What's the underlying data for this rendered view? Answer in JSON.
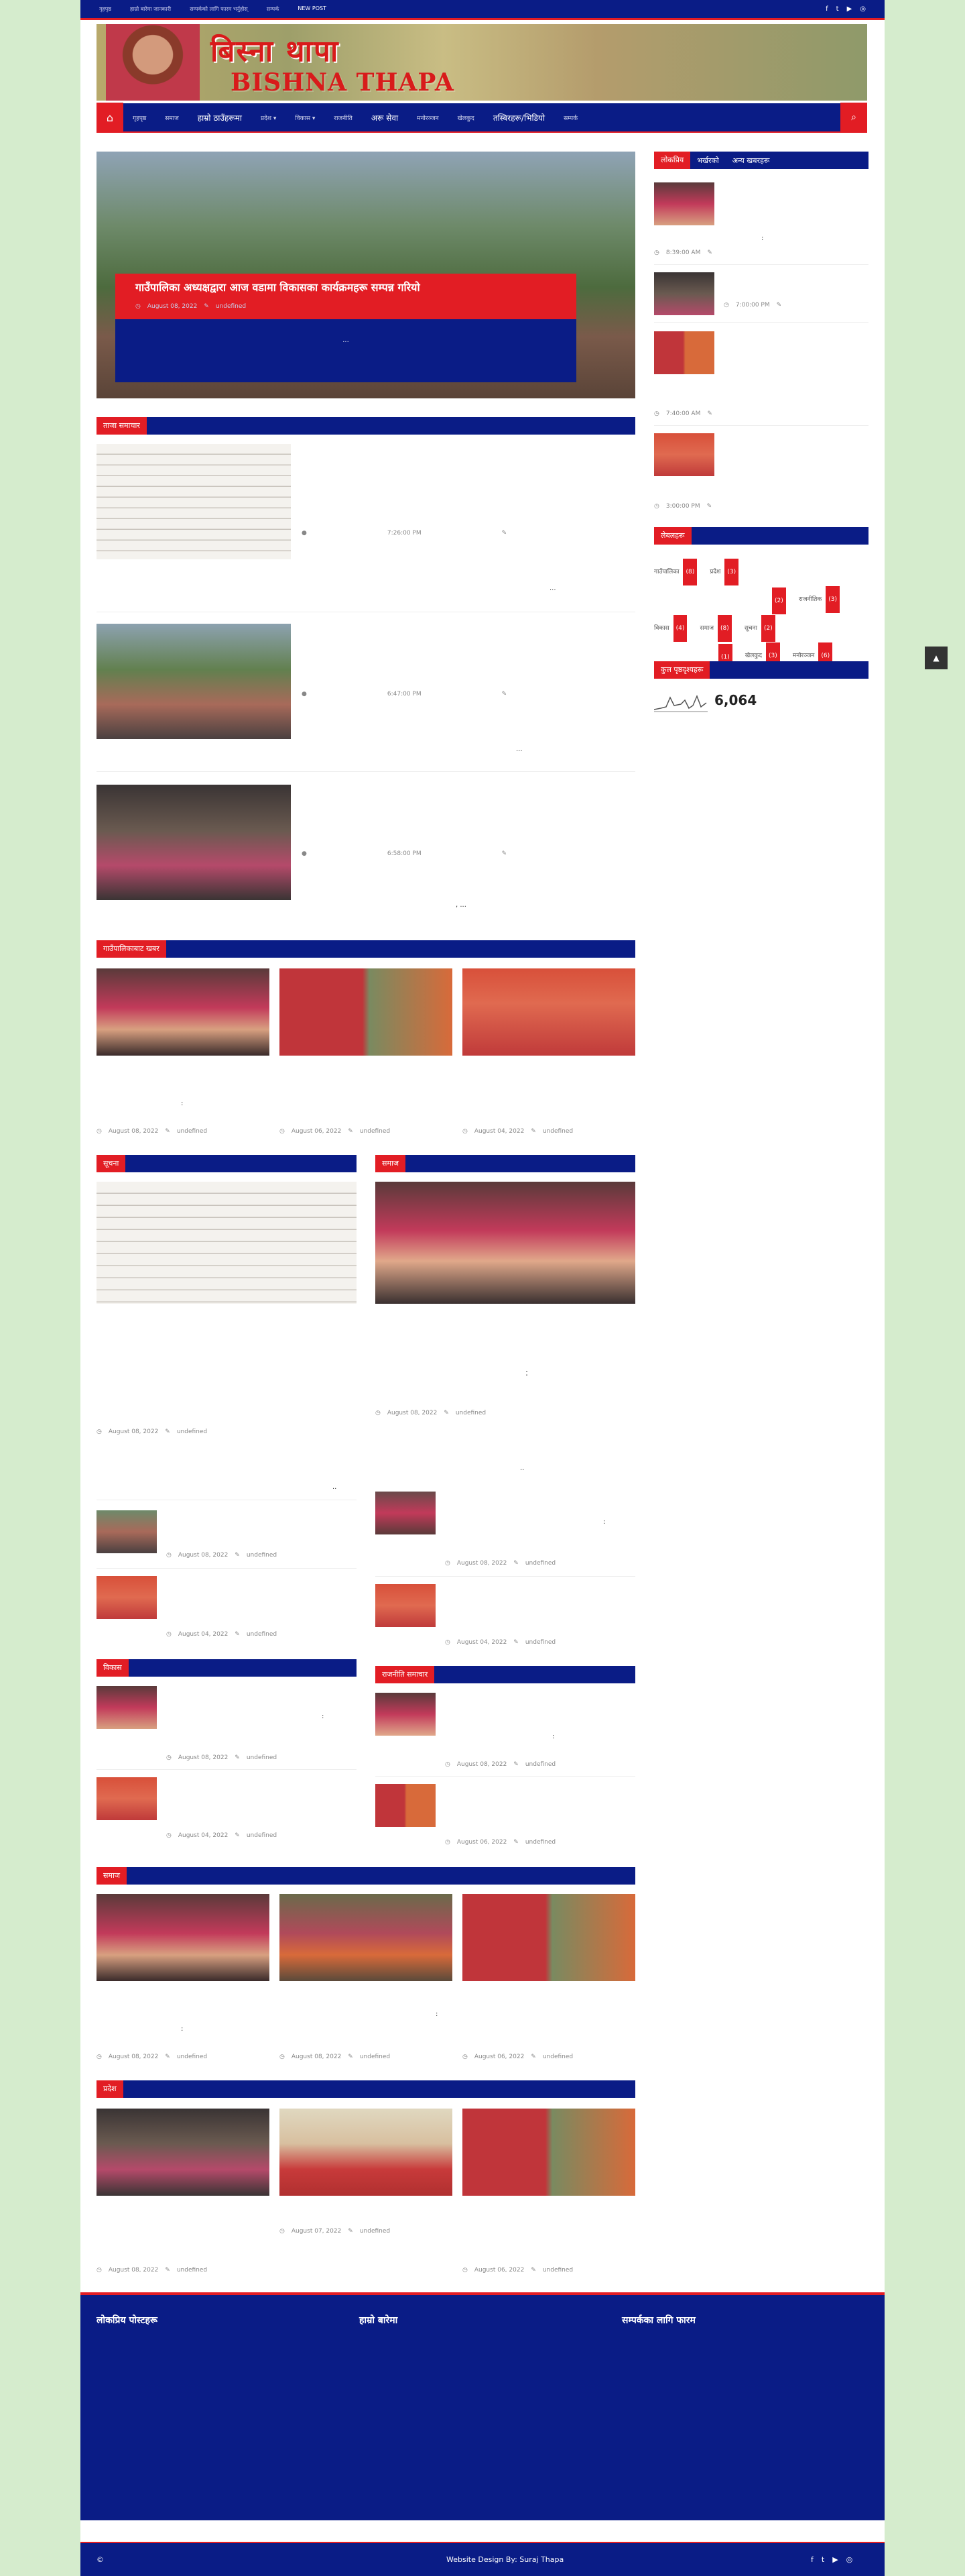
{
  "topbar": {
    "links": [
      "गृहपृष्ठ",
      "हाम्रो बारेमा जानकारी",
      "सम्पर्कको लागि फारम भर्नुहोस्",
      "सम्पर्क",
      "NEW POST"
    ],
    "social": [
      "f",
      "t",
      "▶",
      "◎"
    ]
  },
  "header": {
    "name_devanagari": "बिस्ना थापा",
    "name_latin": "BISHNA THAPA"
  },
  "nav": {
    "items": [
      "गृहपृष्ठ",
      "समाज",
      "हाम्रो ठाउँहरूमा",
      "प्रदेश ▾",
      "विकास ▾",
      "राजनीति",
      "अरू सेवा",
      "मनोरञ्जन",
      "खेलकुद",
      "तस्बिरहरू/भिडियो",
      "सम्पर्क"
    ]
  },
  "featured": {
    "title": "गाउँपालिका अध्यक्षद्वारा आज वडामा विकासका कार्यक्रमहरू सम्पन्न गरियो",
    "date": "August 08, 2022",
    "author": "undefined",
    "excerpt": "..."
  },
  "latest": {
    "heading": "ताजा समाचार",
    "posts": [
      {
        "time": "7:26:00 PM",
        "excerpt": "..."
      },
      {
        "time": "6:47:00 PM",
        "excerpt": "..."
      },
      {
        "time": "6:58:00 PM",
        "excerpt": ", ..."
      }
    ]
  },
  "gallery1": {
    "heading": "गाउँपालिकाबाट खबर",
    "items": [
      {
        "date": "August 08, 2022",
        "author": "undefined",
        "mark": ":"
      },
      {
        "date": "August 06, 2022",
        "author": "undefined"
      },
      {
        "date": "August 04, 2022",
        "author": "undefined"
      }
    ]
  },
  "col_left": {
    "heading": "सूचना",
    "main_date": "August 08, 2022",
    "main_author": "undefined",
    "mark": "..",
    "list": [
      {
        "date": "August 08, 2022",
        "author": "undefined"
      },
      {
        "date": "August 04, 2022",
        "author": "undefined"
      }
    ]
  },
  "col_right": {
    "heading": "समाज",
    "main_date": "August 08, 2022",
    "main_author": "undefined",
    "mark": ":",
    "mark2": "..",
    "list": [
      {
        "date": "August 08, 2022",
        "author": "undefined",
        "mark": ":"
      },
      {
        "date": "August 04, 2022",
        "author": "undefined"
      }
    ]
  },
  "col_left2": {
    "heading": "विकास",
    "list": [
      {
        "date": "August 08, 2022",
        "author": "undefined",
        "mark": ":"
      },
      {
        "date": "August 04, 2022",
        "author": "undefined"
      }
    ]
  },
  "col_right2": {
    "heading": "राजनीति समाचार",
    "list": [
      {
        "date": "August 08, 2022",
        "author": "undefined",
        "mark": ":"
      },
      {
        "date": "August 06, 2022",
        "author": "undefined"
      }
    ]
  },
  "gallery2": {
    "heading": "समाज",
    "items": [
      {
        "date": "August 08, 2022",
        "author": "undefined",
        "mark": ":"
      },
      {
        "date": "August 08, 2022",
        "author": "undefined",
        "mark": ":"
      },
      {
        "date": "August 06, 2022",
        "author": "undefined"
      }
    ]
  },
  "gallery3": {
    "heading": "प्रदेश",
    "items": [
      {
        "date": "August 08, 2022",
        "author": "undefined"
      },
      {
        "date": "August 07, 2022",
        "author": "undefined"
      },
      {
        "date": "August 06, 2022",
        "author": "undefined"
      }
    ]
  },
  "sidebar": {
    "tabs": [
      "लोकप्रिय",
      "भर्खरको",
      "अन्य खबरहरू"
    ],
    "posts": [
      {
        "time": "8:39:00 AM",
        "mark": ":"
      },
      {
        "time": "7:00:00 PM"
      },
      {
        "time": "7:40:00 AM"
      },
      {
        "time": "3:00:00 PM"
      }
    ],
    "labels_heading": "लेबलहरू",
    "labels": [
      {
        "name": "गाउँपालिका",
        "count": "(8)"
      },
      {
        "name": "प्रदेश",
        "count": "(3)"
      },
      {
        "name": "",
        "count": "(2)"
      },
      {
        "name": "राजनीतिक",
        "count": "(3)"
      },
      {
        "name": "विकास",
        "count": "(4)"
      },
      {
        "name": "समाज",
        "count": "(8)"
      },
      {
        "name": "सूचना",
        "count": "(2)"
      },
      {
        "name": "",
        "count": "(1)"
      },
      {
        "name": "खेलकुद",
        "count": "(3)"
      },
      {
        "name": "मनोरञ्जन",
        "count": "(6)"
      }
    ],
    "views_heading": "कुल पृष्ठदृश्यहरू",
    "views": "6,064"
  },
  "footer": {
    "col1": "लोकप्रिय पोस्टहरू",
    "col2": "हाम्रो बारेमा",
    "col3": "सम्पर्कका लागि फारम",
    "copyright": "©",
    "credit": "Website Design By: Suraj Thapa"
  }
}
